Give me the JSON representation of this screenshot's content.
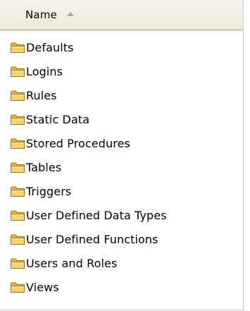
{
  "header": {
    "name_column_label": "Name",
    "sort_indicator": "sort-ascending-icon"
  },
  "items": [
    {
      "label": "Defaults",
      "icon": "folder-icon"
    },
    {
      "label": "Logins",
      "icon": "folder-icon"
    },
    {
      "label": "Rules",
      "icon": "folder-icon"
    },
    {
      "label": "Static Data",
      "icon": "folder-icon"
    },
    {
      "label": "Stored Procedures",
      "icon": "folder-icon"
    },
    {
      "label": "Tables",
      "icon": "folder-icon"
    },
    {
      "label": "Triggers",
      "icon": "folder-icon"
    },
    {
      "label": "User Defined Data Types",
      "icon": "folder-icon"
    },
    {
      "label": "User Defined Functions",
      "icon": "folder-icon"
    },
    {
      "label": "Users and Roles",
      "icon": "folder-icon"
    },
    {
      "label": "Views",
      "icon": "folder-icon"
    }
  ],
  "colors": {
    "header_bg": "#ebeadb",
    "folder_body": "#f6cf5e",
    "folder_outline": "#b08a22"
  }
}
